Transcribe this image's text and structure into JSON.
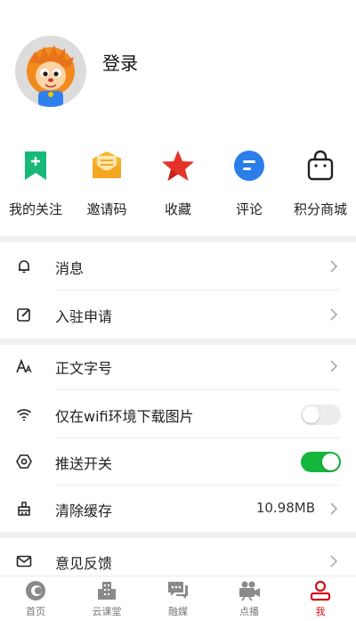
{
  "profile": {
    "login_label": "登录"
  },
  "quick_actions": [
    {
      "label": "我的关注",
      "icon": "bookmark-plus-icon",
      "color": "#17b978"
    },
    {
      "label": "邀请码",
      "icon": "envelope-icon",
      "color": "#f5a623"
    },
    {
      "label": "收藏",
      "icon": "star-icon",
      "color": "#e5332a"
    },
    {
      "label": "评论",
      "icon": "chat-bubble-icon",
      "color": "#2b7de9"
    },
    {
      "label": "积分商城",
      "icon": "shopping-bag-icon",
      "color": "#222222"
    }
  ],
  "menu": {
    "messages": {
      "label": "消息",
      "icon": "bell-icon"
    },
    "apply": {
      "label": "入驻申请",
      "icon": "edit-icon"
    },
    "font_size": {
      "label": "正文字号",
      "icon": "font-size-icon"
    },
    "wifi_images": {
      "label": "仅在wifi环境下载图片",
      "icon": "wifi-icon",
      "enabled": false
    },
    "push": {
      "label": "推送开关",
      "icon": "push-settings-icon",
      "enabled": true
    },
    "cache": {
      "label": "清除缓存",
      "icon": "broom-icon",
      "value": "10.98MB"
    },
    "feedback": {
      "label": "意见反馈",
      "icon": "mail-icon"
    }
  },
  "tabs": [
    {
      "label": "首页",
      "icon": "home-logo-icon",
      "active": false
    },
    {
      "label": "云课堂",
      "icon": "building-icon",
      "active": false
    },
    {
      "label": "融媒",
      "icon": "media-chat-icon",
      "active": false
    },
    {
      "label": "点播",
      "icon": "video-camera-icon",
      "active": false
    },
    {
      "label": "我",
      "icon": "person-icon",
      "active": true
    }
  ],
  "colors": {
    "accent": "#d0121b",
    "toggle_on": "#14b73c",
    "divider": "#f1f1f1"
  }
}
